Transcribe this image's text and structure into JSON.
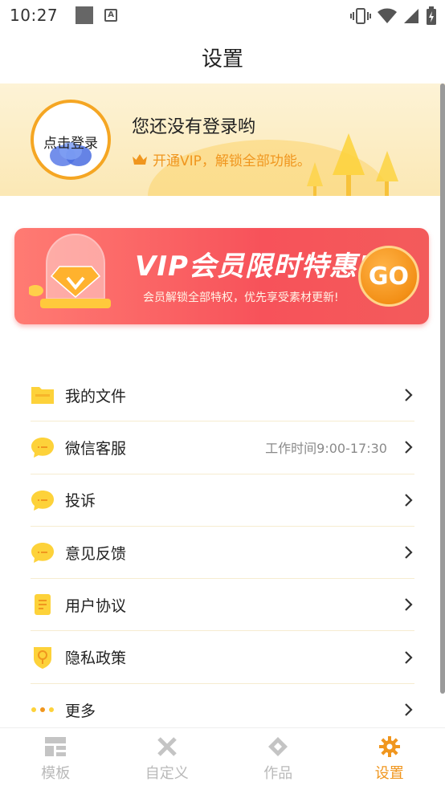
{
  "status_bar": {
    "time": "10:27",
    "a_badge": "A"
  },
  "header": {
    "title": "设置"
  },
  "profile": {
    "avatar_label": "点击登录",
    "login_prompt": "您还没有登录哟",
    "vip_tip": "开通VIP，解锁全部功能。"
  },
  "banner": {
    "title": "VIP会员限时特惠!",
    "subtitle": "会员解锁全部特权，优先享受素材更新!",
    "go_label": "GO"
  },
  "menu": {
    "items": [
      {
        "label": "我的文件",
        "icon": "folder-icon",
        "note": ""
      },
      {
        "label": "微信客服",
        "icon": "chat-bubble-icon",
        "note": "工作时间9:00-17:30"
      },
      {
        "label": "投诉",
        "icon": "chat-bubble-icon",
        "note": ""
      },
      {
        "label": "意见反馈",
        "icon": "chat-bubble-icon",
        "note": ""
      },
      {
        "label": "用户协议",
        "icon": "document-icon",
        "note": ""
      },
      {
        "label": "隐私政策",
        "icon": "lightbulb-shield-icon",
        "note": ""
      },
      {
        "label": "更多",
        "icon": "more-dots-icon",
        "note": ""
      }
    ]
  },
  "tabbar": {
    "tabs": [
      {
        "label": "模板",
        "icon": "template-grid-icon",
        "active": false
      },
      {
        "label": "自定义",
        "icon": "tools-icon",
        "active": false
      },
      {
        "label": "作品",
        "icon": "works-diamond-icon",
        "active": false
      },
      {
        "label": "设置",
        "icon": "gear-icon",
        "active": true
      }
    ]
  },
  "colors": {
    "accent": "#f0961e",
    "header_bg": "#fdf3d6",
    "banner_red": "#f7525a",
    "icon_yellow": "#fdd23a",
    "divider": "#f6ecd0"
  }
}
